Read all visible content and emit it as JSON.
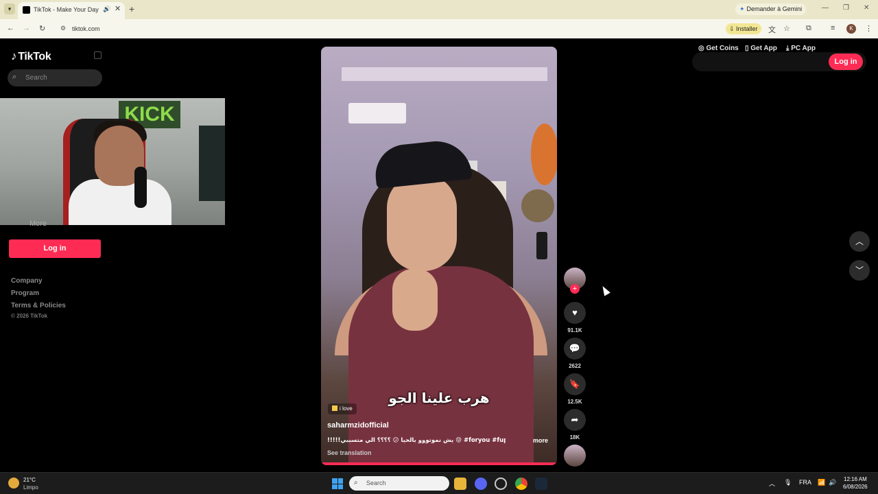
{
  "browser": {
    "tab_title": "TikTok - Make Your Day",
    "gemini_label": "Demander à Gemini",
    "address": "tiktok.com",
    "install_label": "Installer",
    "profile_initial": "K"
  },
  "sidebar": {
    "logo": "TikTok",
    "search_placeholder": "Search",
    "more_label": "More",
    "login_label": "Log in",
    "footer_links": [
      "Company",
      "Program",
      "Terms & Policies"
    ],
    "copyright": "© 2026 TikTok"
  },
  "webcam_sign": "KICK",
  "video": {
    "caption": "هرب علينا الجو",
    "tag": "i love",
    "username": "saharmzidofficial",
    "description": "!!!!!يش نموتووو بالحيا 😕 ؟؟؟؟ الي متسببي 😝 #foryou #fup ...",
    "more_label": "more",
    "see_translation": "See translation"
  },
  "actions": {
    "likes": "91.1K",
    "comments": "2622",
    "saves": "12.5K",
    "shares": "18K",
    "follow_symbol": "+"
  },
  "top_actions": {
    "get_coins": "Get Coins",
    "get_app": "Get App",
    "pc_app": "PC App",
    "login": "Log in"
  },
  "taskbar": {
    "temperature": "21°C",
    "weather": "Limpo",
    "search_placeholder": "Search",
    "language": "FRA",
    "time": "12:16 AM",
    "date": "6/08/2026"
  },
  "colors": {
    "accent": "#fe2c55",
    "background": "#000000",
    "chrome": "#f7f6ec"
  }
}
